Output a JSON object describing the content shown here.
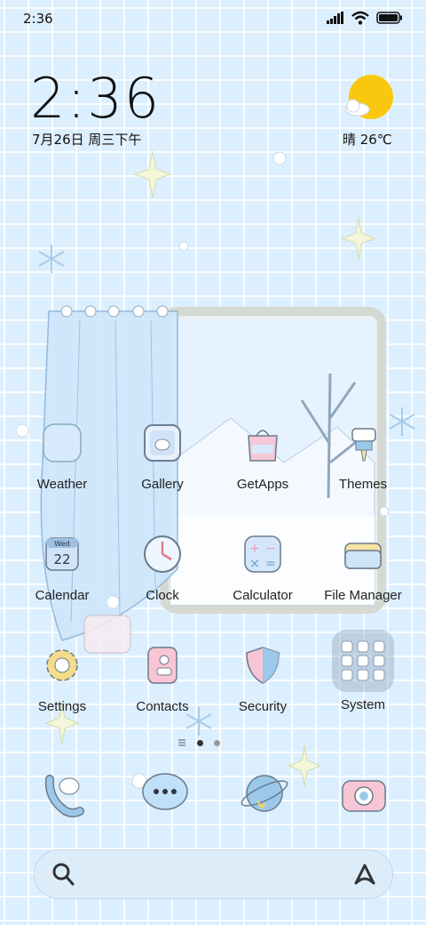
{
  "status_bar": {
    "time": "2:36"
  },
  "clock_widget": {
    "time": "2:36",
    "date": "7月26日 周三下午"
  },
  "weather_widget": {
    "text": "晴 26℃"
  },
  "apps": [
    {
      "label": "Weather",
      "icon": "weather-icon"
    },
    {
      "label": "Gallery",
      "icon": "gallery-icon"
    },
    {
      "label": "GetApps",
      "icon": "getapps-icon"
    },
    {
      "label": "Themes",
      "icon": "themes-icon"
    },
    {
      "label": "Calendar",
      "icon": "calendar-icon",
      "badge": "Wed",
      "day": "22"
    },
    {
      "label": "Clock",
      "icon": "clock-icon"
    },
    {
      "label": "Calculator",
      "icon": "calculator-icon"
    },
    {
      "label": "File Manager",
      "icon": "file-manager-icon"
    },
    {
      "label": "Settings",
      "icon": "settings-icon"
    },
    {
      "label": "Contacts",
      "icon": "contacts-icon"
    },
    {
      "label": "Security",
      "icon": "security-icon"
    },
    {
      "label": "System",
      "icon": "system-folder-icon"
    }
  ],
  "page_indicator": {
    "pages": 2,
    "current": 1
  },
  "dock": [
    {
      "icon": "phone-icon"
    },
    {
      "icon": "messages-icon"
    },
    {
      "icon": "browser-icon"
    },
    {
      "icon": "camera-icon"
    }
  ],
  "colors": {
    "background": "#dcefff",
    "sun": "#f9c80e",
    "accent_pink": "#f4b6c8",
    "accent_blue": "#9cc8ea"
  }
}
